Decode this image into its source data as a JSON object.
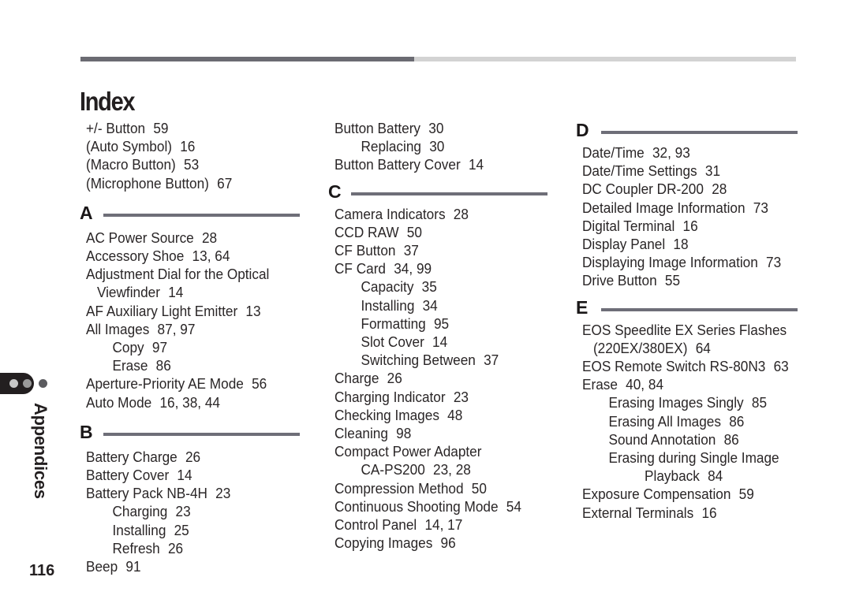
{
  "page": {
    "title": "Index",
    "section_tab": "Appendices",
    "page_number": "116",
    "colors": {
      "rule": "#6e6e78",
      "top_bar_dark": "#6b6b72",
      "top_bar_light": "#d3d3d3",
      "text": "#231f20"
    },
    "progress_fraction": 0.47
  },
  "columns": [
    {
      "blocks": [
        {
          "letter": "",
          "entries": [
            {
              "level": 0,
              "term": "+/- Button",
              "pages": "59"
            },
            {
              "level": 0,
              "term": "(Auto Symbol)",
              "pages": "16"
            },
            {
              "level": 0,
              "term": "(Macro Button)",
              "pages": "53"
            },
            {
              "level": 0,
              "term": "(Microphone Button)",
              "pages": "67"
            }
          ]
        },
        {
          "letter": "A",
          "entries": [
            {
              "level": 0,
              "term": "AC Power Source",
              "pages": "28"
            },
            {
              "level": 0,
              "term": "Accessory Shoe",
              "pages": "13, 64"
            },
            {
              "level": 0,
              "term": "Adjustment Dial for the Optical",
              "pages": ""
            },
            {
              "level": 2,
              "term": "Viewfinder",
              "pages": "14"
            },
            {
              "level": 0,
              "term": "AF Auxiliary Light Emitter",
              "pages": "13"
            },
            {
              "level": 0,
              "term": "All Images",
              "pages": "87, 97"
            },
            {
              "level": 1,
              "term": "Copy",
              "pages": "97"
            },
            {
              "level": 1,
              "term": "Erase",
              "pages": "86"
            },
            {
              "level": 0,
              "term": "Aperture-Priority AE Mode",
              "pages": "56"
            },
            {
              "level": 0,
              "term": "Auto Mode",
              "pages": "16, 38, 44"
            }
          ]
        },
        {
          "letter": "B",
          "entries": [
            {
              "level": 0,
              "term": "Battery Charge",
              "pages": "26"
            },
            {
              "level": 0,
              "term": "Battery Cover",
              "pages": "14"
            },
            {
              "level": 0,
              "term": "Battery Pack NB-4H",
              "pages": "23"
            },
            {
              "level": 1,
              "term": "Charging",
              "pages": "23"
            },
            {
              "level": 1,
              "term": "Installing",
              "pages": "25"
            },
            {
              "level": 1,
              "term": "Refresh",
              "pages": "26"
            },
            {
              "level": 0,
              "term": "Beep",
              "pages": "91"
            }
          ]
        }
      ]
    },
    {
      "blocks": [
        {
          "letter": "",
          "entries": [
            {
              "level": 0,
              "term": "Button Battery",
              "pages": "30"
            },
            {
              "level": 1,
              "term": "Replacing",
              "pages": "30"
            },
            {
              "level": 0,
              "term": "Button Battery Cover",
              "pages": "14"
            }
          ]
        },
        {
          "letter": "C",
          "entries": [
            {
              "level": 0,
              "term": "Camera Indicators",
              "pages": "28"
            },
            {
              "level": 0,
              "term": "CCD RAW",
              "pages": "50"
            },
            {
              "level": 0,
              "term": "CF Button",
              "pages": "37"
            },
            {
              "level": 0,
              "term": "CF Card",
              "pages": "34, 99"
            },
            {
              "level": 1,
              "term": "Capacity",
              "pages": "35"
            },
            {
              "level": 1,
              "term": "Installing",
              "pages": "34"
            },
            {
              "level": 1,
              "term": "Formatting",
              "pages": "95"
            },
            {
              "level": 1,
              "term": "Slot Cover",
              "pages": "14"
            },
            {
              "level": 1,
              "term": "Switching Between",
              "pages": "37"
            },
            {
              "level": 0,
              "term": "Charge",
              "pages": "26"
            },
            {
              "level": 0,
              "term": "Charging Indicator",
              "pages": "23"
            },
            {
              "level": 0,
              "term": "Checking Images",
              "pages": "48"
            },
            {
              "level": 0,
              "term": "Cleaning",
              "pages": "98"
            },
            {
              "level": 0,
              "term": "Compact Power Adapter",
              "pages": ""
            },
            {
              "level": 1,
              "term": "CA-PS200",
              "pages": "23, 28"
            },
            {
              "level": 0,
              "term": "Compression Method",
              "pages": "50"
            },
            {
              "level": 0,
              "term": "Continuous Shooting Mode",
              "pages": "54"
            },
            {
              "level": 0,
              "term": "Control Panel",
              "pages": "14, 17"
            },
            {
              "level": 0,
              "term": "Copying Images",
              "pages": "96"
            }
          ]
        }
      ]
    },
    {
      "blocks": [
        {
          "letter": "D",
          "entries": [
            {
              "level": 0,
              "term": "Date/Time",
              "pages": "32, 93"
            },
            {
              "level": 0,
              "term": "Date/Time Settings",
              "pages": "31"
            },
            {
              "level": 0,
              "term": "DC Coupler DR-200",
              "pages": "28"
            },
            {
              "level": 0,
              "term": "Detailed Image Information",
              "pages": "73"
            },
            {
              "level": 0,
              "term": "Digital Terminal",
              "pages": "16"
            },
            {
              "level": 0,
              "term": "Display Panel",
              "pages": "18"
            },
            {
              "level": 0,
              "term": "Displaying Image Information",
              "pages": "73"
            },
            {
              "level": 0,
              "term": "Drive Button",
              "pages": "55"
            }
          ]
        },
        {
          "letter": "E",
          "entries": [
            {
              "level": 0,
              "term": "EOS Speedlite EX Series Flashes",
              "pages": ""
            },
            {
              "level": 2,
              "term": "(220EX/380EX)",
              "pages": "64"
            },
            {
              "level": 0,
              "term": "EOS Remote Switch RS-80N3",
              "pages": "63"
            },
            {
              "level": 0,
              "term": "Erase",
              "pages": "40, 84"
            },
            {
              "level": 1,
              "term": "Erasing Images Singly",
              "pages": "85"
            },
            {
              "level": 1,
              "term": "Erasing All Images",
              "pages": "86"
            },
            {
              "level": 1,
              "term": "Sound Annotation",
              "pages": "86"
            },
            {
              "level": 1,
              "term": "Erasing during Single Image",
              "pages": ""
            },
            {
              "level": 3,
              "term": "Playback",
              "pages": "84"
            },
            {
              "level": 0,
              "term": "Exposure Compensation",
              "pages": "59"
            },
            {
              "level": 0,
              "term": "External Terminals",
              "pages": "16"
            }
          ]
        }
      ]
    }
  ]
}
